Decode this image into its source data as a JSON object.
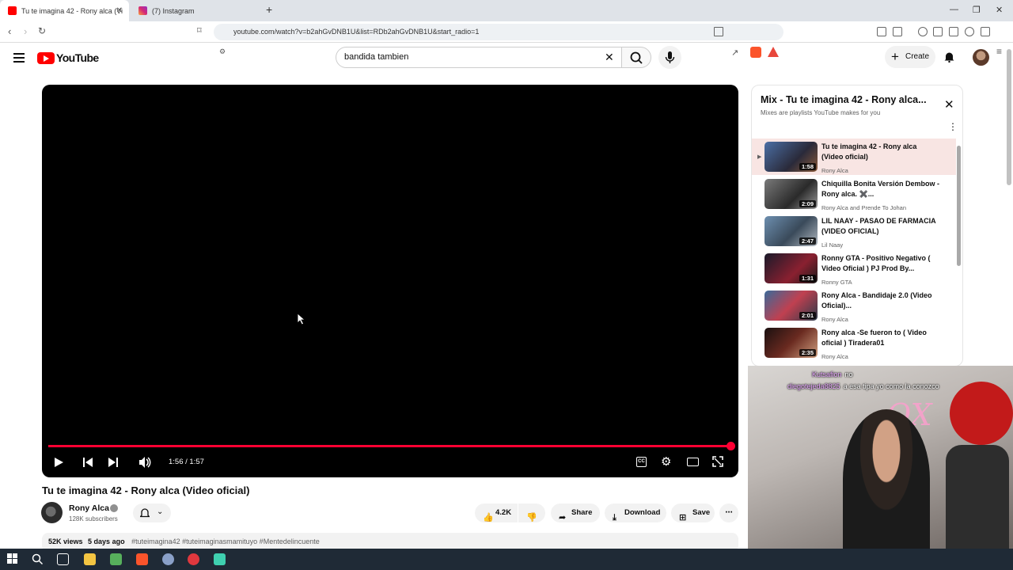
{
  "browser": {
    "tabs": [
      {
        "label": "Tu te imagina 42 - Rony alca (Vi",
        "active": true
      },
      {
        "label": "(7) Instagram",
        "active": false
      }
    ],
    "new_tab": "+",
    "url": "youtube.com/watch?v=b2ahGvDNB1U&list=RDb2ahGvDNB1U&start_radio=1"
  },
  "header": {
    "logo": "YouTube",
    "search_value": "bandida tambien",
    "create_label": "Create"
  },
  "player": {
    "time": "1:56 / 1:57",
    "progress": 0.99
  },
  "video": {
    "title": "Tu te imagina 42 - Rony alca (Video oficial)",
    "channel": "Rony Alca",
    "subscribers": "128K subscribers",
    "likes": "4.2K",
    "share_label": "Share",
    "download_label": "Download",
    "save_label": "Save",
    "views": "52K views",
    "age": "5 days ago",
    "tags": "#tuteimagina42 #tuteimaginasmamituyo #Mentedelincuente"
  },
  "playlist": {
    "title": "Mix - Tu te imagina 42 - Rony alca...",
    "subtitle": "Mixes are playlists YouTube makes for you",
    "items": [
      {
        "title": "Tu te imagina 42 - Rony alca (Video oficial)",
        "channel": "Rony Alca",
        "duration": "1:58",
        "active": true,
        "color": "#3d4a6b"
      },
      {
        "title": "Chiquilla Bonita Versión Dembow - Rony alca. ✖️...",
        "channel": "Rony Alca and Prende To Johan",
        "duration": "2:09",
        "active": false,
        "color": "#5a5a5a"
      },
      {
        "title": "LIL NAAY - PASAO DE FARMACIA (VIDEO OFICIAL)",
        "channel": "Lil Naay",
        "duration": "2:47",
        "active": false,
        "color": "#3f5b73"
      },
      {
        "title": "Ronny GTA - Positivo Negativo ( Video Oficial ) PJ Prod By...",
        "channel": "Ronny GTA",
        "duration": "1:31",
        "active": false,
        "color": "#4a1f2a"
      },
      {
        "title": "Rony Alca - Bandidaje 2.0 (Video Oficial)...",
        "channel": "Rony Alca",
        "duration": "2:01",
        "active": false,
        "color": "#2f4b66"
      },
      {
        "title": "Rony alca -Se fueron to ( Video oficial ) Tiradera01",
        "channel": "Rony Alca",
        "duration": "2:35",
        "active": false,
        "color": "#3a2020"
      }
    ]
  },
  "stream": {
    "chat": [
      {
        "user": "Kutsafion",
        "msg": "no"
      },
      {
        "user": "diegotejeda8825",
        "msg": "a esa tipa yo como la conozco"
      }
    ],
    "neon": "OX"
  }
}
